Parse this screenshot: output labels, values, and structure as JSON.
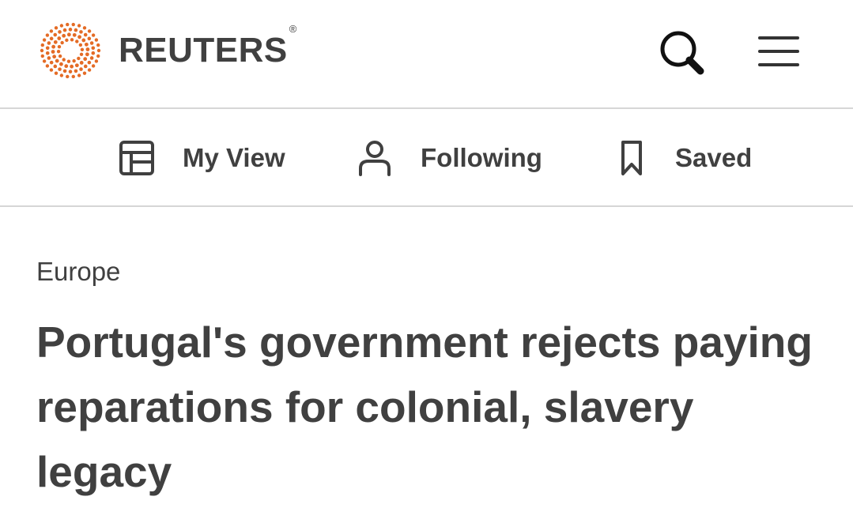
{
  "header": {
    "brand": "REUTERS",
    "registered_mark": "®",
    "brand_color": "#e46b25",
    "icons": [
      "reuters-logo-icon",
      "search-icon",
      "hamburger-menu-icon"
    ]
  },
  "subnav": {
    "items": [
      {
        "label": "My View",
        "icon": "layout-icon"
      },
      {
        "label": "Following",
        "icon": "person-icon"
      },
      {
        "label": "Saved",
        "icon": "bookmark-icon"
      }
    ]
  },
  "article": {
    "section": "Europe",
    "headline": "Portugal's government rejects paying reparations for colonial, slavery legacy"
  },
  "colors": {
    "text": "#404040",
    "divider": "#d6d6d6",
    "background": "#ffffff"
  }
}
